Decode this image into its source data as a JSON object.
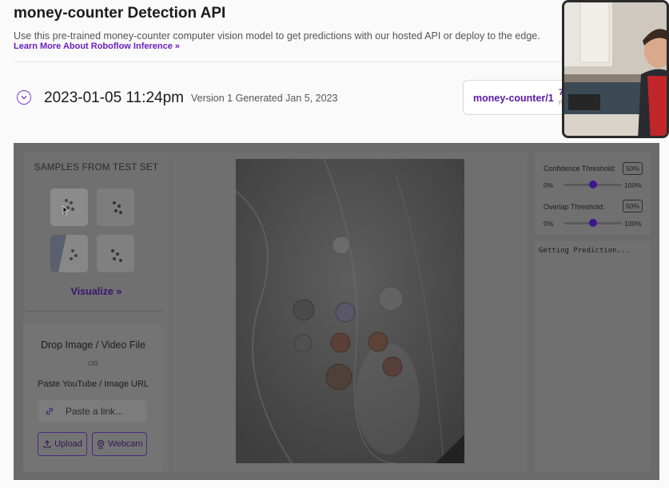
{
  "header": {
    "title": "money-counter Detection API",
    "description": "Use this pre-trained money-counter computer vision model to get predictions with our hosted API or deploy to the edge.",
    "learn_more": "Learn More About Roboflow Inference »"
  },
  "version": {
    "date": "2023-01-05 11:24pm",
    "info": "Version 1 Generated Jan 5, 2023",
    "model_id": "money-counter/1",
    "extra1": "7",
    "extra2": "n"
  },
  "samples": {
    "title": "SAMPLES FROM TEST SET",
    "visualize": "Visualize »"
  },
  "upload": {
    "drop_title": "Drop Image / Video File",
    "or": "OR",
    "paste_label": "Paste YouTube / Image URL",
    "link_placeholder": "Paste a link...",
    "upload_label": "Upload",
    "webcam_label": "Webcam"
  },
  "settings": {
    "confidence_label": "Confidence Threshold:",
    "confidence_value": "50%",
    "confidence_fraction": 0.5,
    "overlap_label": "Overlap Threshold:",
    "overlap_value": "50%",
    "overlap_fraction": 0.5,
    "min": "0%",
    "max": "100%"
  },
  "output": {
    "status": "Getting Prediction..."
  },
  "colors": {
    "accent": "#6a1fc0",
    "slider_knob": "#3d1590"
  }
}
